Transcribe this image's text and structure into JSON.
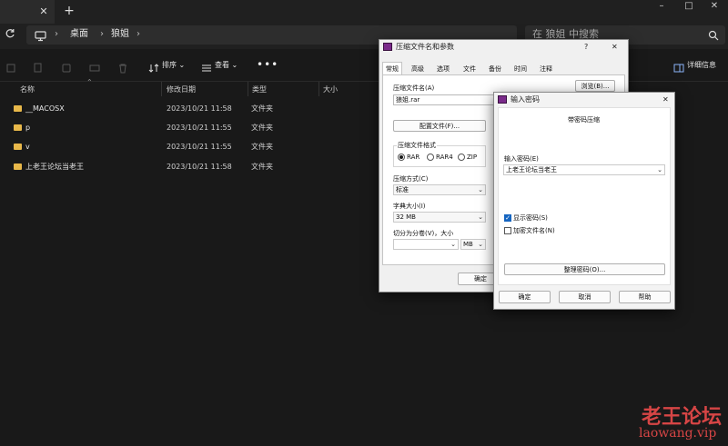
{
  "window": {
    "tab_close": "✕",
    "tab_new": "+",
    "minimize": "–",
    "maximize": "□",
    "close": "✕"
  },
  "address": {
    "crumbs": [
      "桌面",
      "狼姐"
    ],
    "search_placeholder": "在 狼姐 中搜索"
  },
  "toolbar": {
    "sort_label": "排序",
    "view_label": "查看",
    "more_label": "•••",
    "details_label": "详细信息"
  },
  "list": {
    "columns": [
      "名称",
      "修改日期",
      "类型",
      "大小"
    ],
    "rows": [
      {
        "name": "__MACOSX",
        "date": "2023/10/21 11:58",
        "type": "文件夹"
      },
      {
        "name": "p",
        "date": "2023/10/21 11:55",
        "type": "文件夹"
      },
      {
        "name": "v",
        "date": "2023/10/21 11:55",
        "type": "文件夹"
      },
      {
        "name": "上老王论坛当老王",
        "date": "2023/10/21 11:58",
        "type": "文件夹"
      }
    ]
  },
  "archive_dialog": {
    "title": "压缩文件名和参数",
    "help": "?",
    "close": "✕",
    "tabs": [
      "常规",
      "高级",
      "选项",
      "文件",
      "备份",
      "时间",
      "注释"
    ],
    "filename_label": "压缩文件名(A)",
    "filename_value": "狼姐.rar",
    "browse_label": "浏览(B)...",
    "profiles_label": "配置文件(F)...",
    "format_label": "压缩文件格式",
    "formats": [
      "RAR",
      "RAR4",
      "ZIP"
    ],
    "method_label": "压缩方式(C)",
    "method_value": "标准",
    "dict_label": "字典大小(I)",
    "dict_value": "32 MB",
    "split_label": "切分为分卷(V)，大小",
    "split_unit": "MB",
    "ok_label": "确定"
  },
  "password_dialog": {
    "title": "输入密码",
    "close": "✕",
    "heading": "带密码压缩",
    "enter_label": "输入密码(E)",
    "password_value": "上老王论坛当老王",
    "show_label": "显示密码(S)",
    "encrypt_label": "加密文件名(N)",
    "organize_label": "整理密码(O)...",
    "ok_label": "确定",
    "cancel_label": "取消",
    "help_label": "帮助"
  },
  "watermark": {
    "cn": "老王论坛",
    "url": "laowang.vip"
  },
  "colors": {
    "bg": "#191919",
    "folder": "#e8b84a",
    "accent": "#1565c0",
    "watermark": "#d64545"
  }
}
